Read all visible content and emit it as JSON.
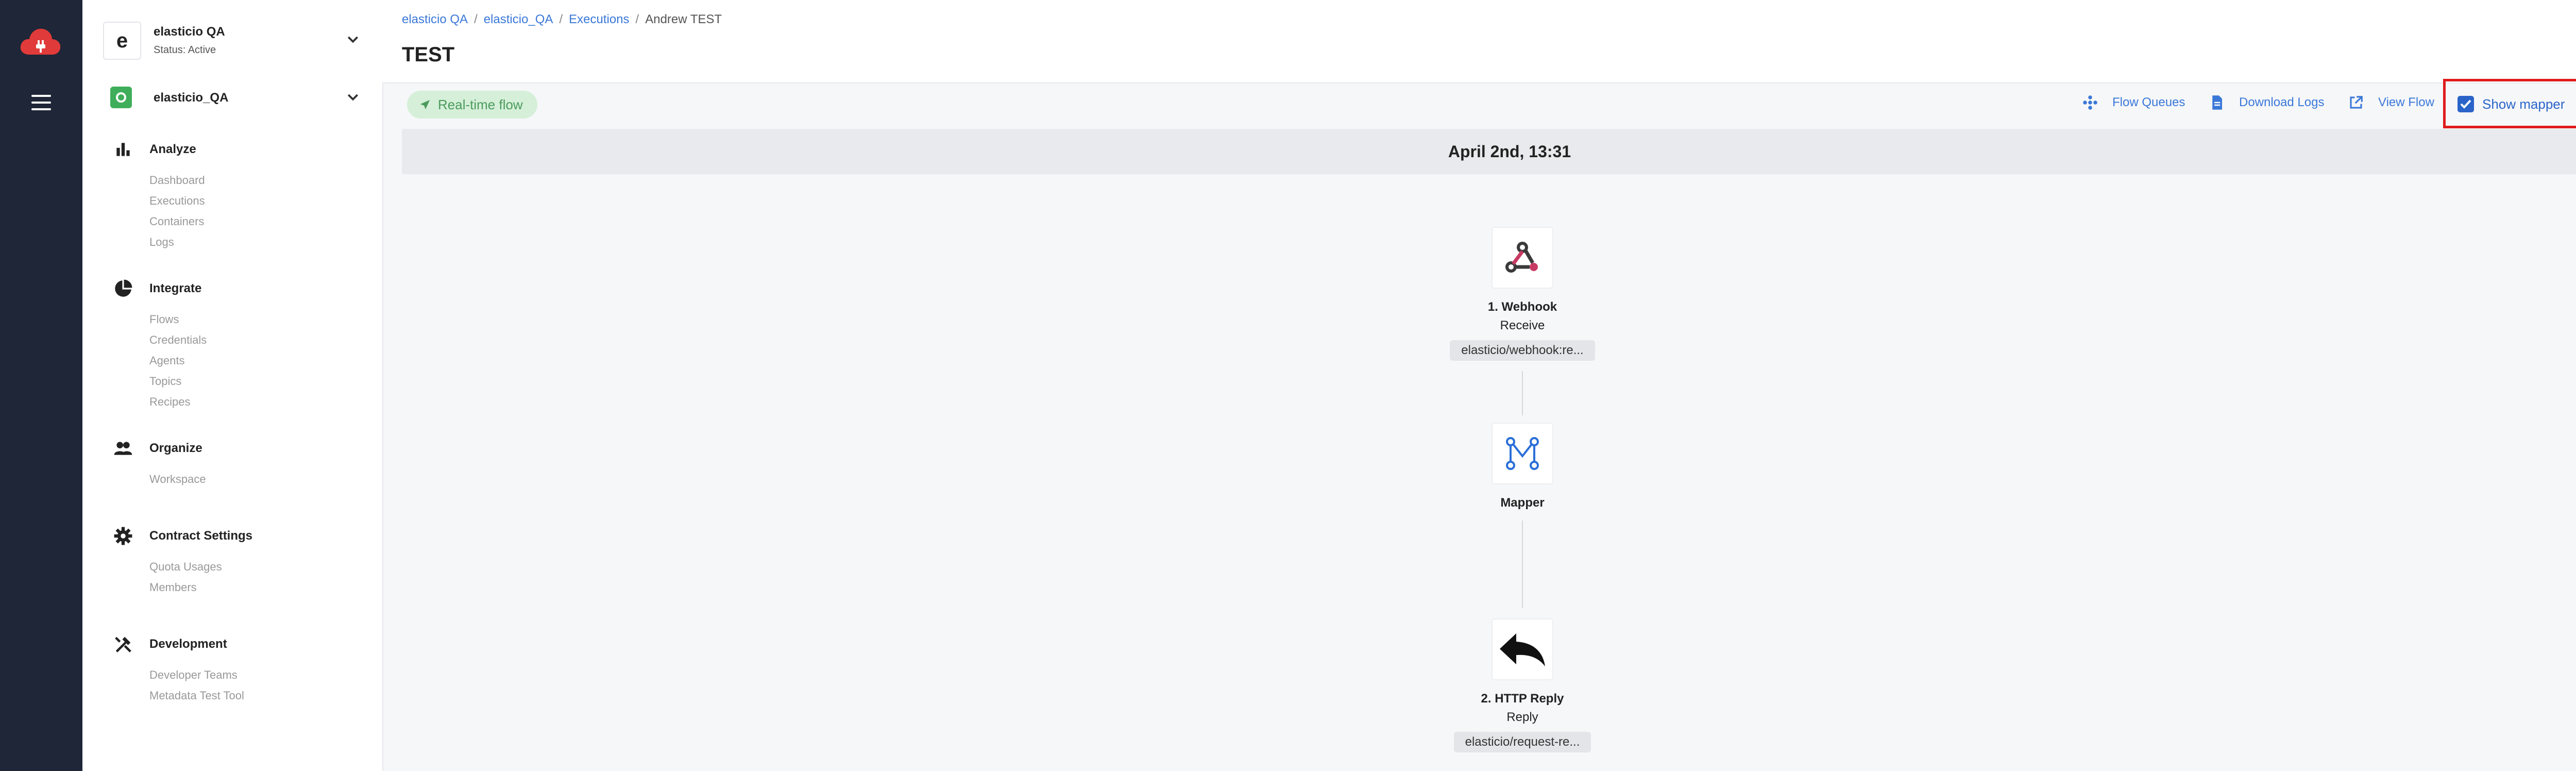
{
  "workspace": {
    "name": "elasticio QA",
    "status": "Status: Active",
    "avatar_letter": "e"
  },
  "workspace2": {
    "name": "elasticio_QA"
  },
  "sidebar": {
    "sections": [
      {
        "title": "Analyze",
        "icon": "bar-chart-icon",
        "items": [
          "Dashboard",
          "Executions",
          "Containers",
          "Logs"
        ]
      },
      {
        "title": "Integrate",
        "icon": "pie-chart-icon",
        "items": [
          "Flows",
          "Credentials",
          "Agents",
          "Topics",
          "Recipes"
        ]
      },
      {
        "title": "Organize",
        "icon": "people-icon",
        "items": [
          "Workspace"
        ]
      },
      {
        "title": "Contract Settings",
        "icon": "gear-icon",
        "items": [
          "Quota Usages",
          "Members"
        ]
      },
      {
        "title": "Development",
        "icon": "tools-icon",
        "items": [
          "Developer Teams",
          "Metadata Test Tool"
        ]
      }
    ]
  },
  "breadcrumb": {
    "items": [
      "elasticio QA",
      "elasticio_QA",
      "Executions"
    ],
    "current": "Andrew TEST"
  },
  "page": {
    "title": "TEST"
  },
  "flow_badge": "Real-time flow",
  "actions": {
    "flow_queues": "Flow Queues",
    "download_logs": "Download Logs",
    "view_flow": "View Flow",
    "show_mapper": "Show mapper"
  },
  "date_band": "April 2nd, 13:31",
  "nodes": [
    {
      "title": "1. Webhook",
      "subtitle": "Receive",
      "pill": "elasticio/webhook:re...",
      "icon": "webhook-icon"
    },
    {
      "title": "Mapper",
      "icon": "mapper-icon"
    },
    {
      "title": "2. HTTP Reply",
      "subtitle": "Reply",
      "pill": "elasticio/request-re...",
      "icon": "reply-arrow-icon"
    }
  ],
  "colors": {
    "rail": "#1e2637",
    "link": "#3a78d8",
    "highlight": "#e01b1b",
    "badge_bg": "#d5efd9",
    "badge_text": "#4c9b5c"
  }
}
